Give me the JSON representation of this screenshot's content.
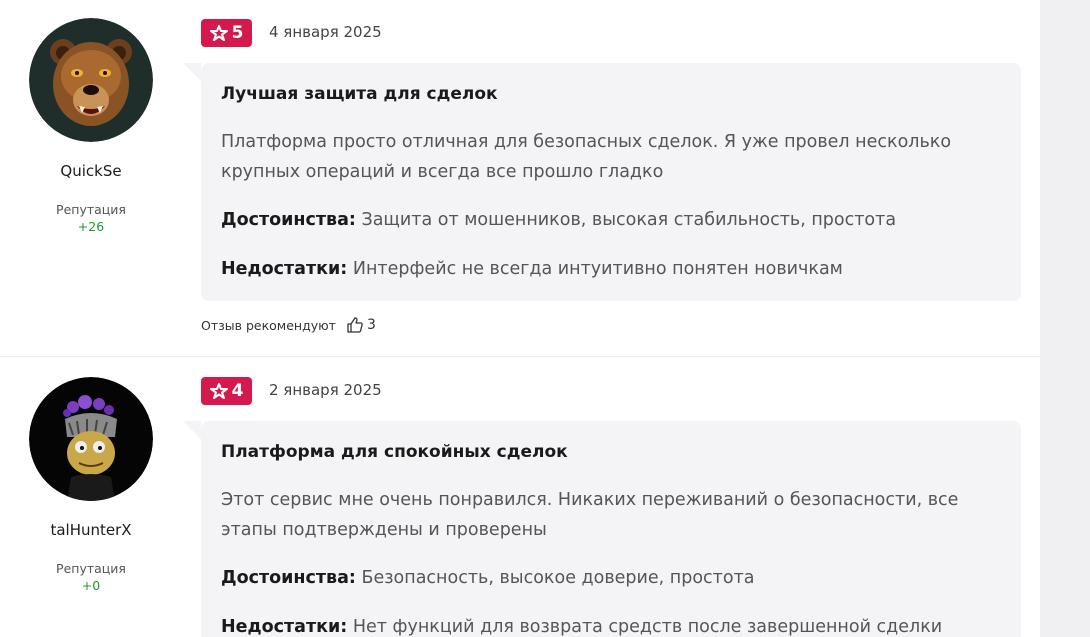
{
  "reviews": [
    {
      "author": "QuickSe",
      "reputation_label": "Репутация",
      "reputation_value": "+26",
      "rating": "5",
      "date": "4 января 2025",
      "title": "Лучшая защита для сделок",
      "text": "Платформа просто отличная для безопасных сделок. Я уже провел несколько крупных операций и всегда все прошло гладко",
      "pros_label": "Достоинства:",
      "pros": "Защита от мошенников, высокая стабильность, простота",
      "cons_label": "Недостатки:",
      "cons": "Интерфейс не всегда интуитивно понятен новичкам",
      "recommend_label": "Отзыв рекомендуют",
      "recommend_count": "3"
    },
    {
      "author": "talHunterX",
      "reputation_label": "Репутация",
      "reputation_value": "+0",
      "rating": "4",
      "date": "2 января 2025",
      "title": "Платформа для спокойных сделок",
      "text": "Этот сервис мне очень понравился. Никаких переживаний о безопасности, все этапы подтверждены и проверены",
      "pros_label": "Достоинства:",
      "pros": "Безопасность, высокое доверие, простота",
      "cons_label": "Недостатки:",
      "cons": "Нет функций для возврата средств после завершенной сделки"
    }
  ],
  "colors": {
    "badge": "#d3194e",
    "reputation": "#1f9a2e",
    "bubble": "#f4f4f6"
  }
}
